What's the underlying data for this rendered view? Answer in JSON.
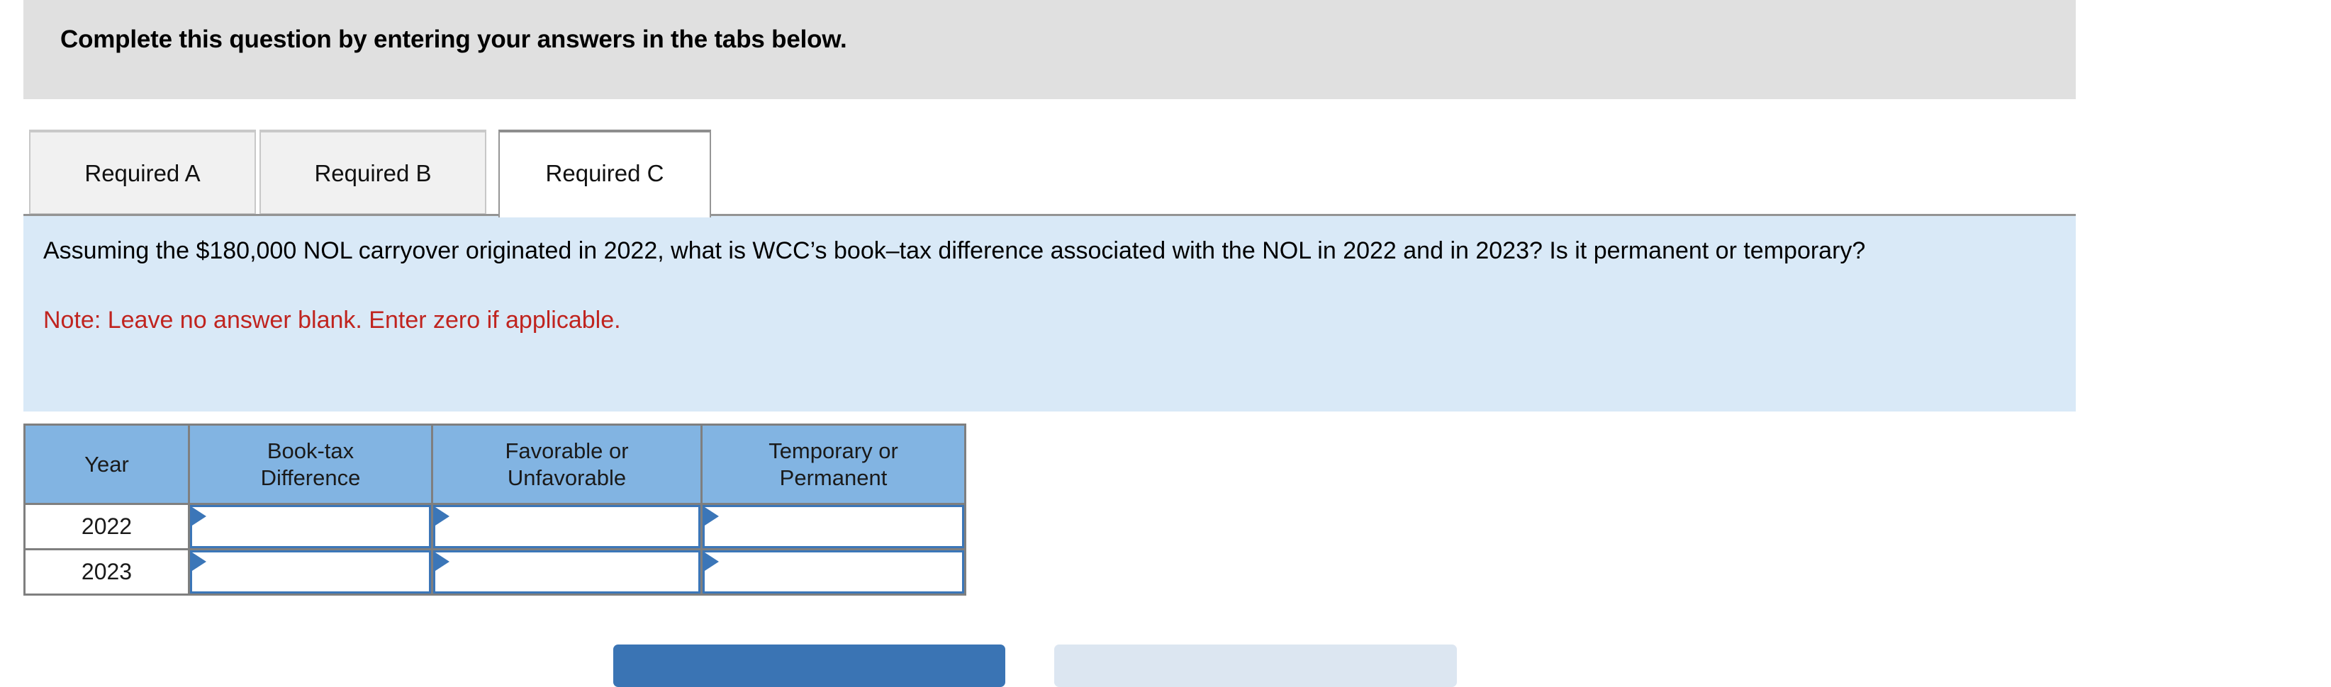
{
  "banner": {
    "text": "Complete this question by entering your answers in the tabs below."
  },
  "tabs": [
    {
      "label": "Required A",
      "active": false
    },
    {
      "label": "Required B",
      "active": false
    },
    {
      "label": "Required C",
      "active": true
    }
  ],
  "question": {
    "text": "Assuming the $180,000 NOL carryover originated in 2022, what is WCC’s book–tax difference associated with the NOL in 2022 and in 2023? Is it permanent or temporary?",
    "note": "Note: Leave no answer blank. Enter zero if applicable."
  },
  "table": {
    "headers": {
      "year": "Year",
      "book_tax_difference": "Book-tax\nDifference",
      "favorable_or_unfavorable": "Favorable or\nUnfavorable",
      "temporary_or_permanent": "Temporary or\nPermanent"
    },
    "rows": [
      {
        "year": "2022",
        "book_tax_difference": "",
        "favorable_or_unfavorable": "",
        "temporary_or_permanent": ""
      },
      {
        "year": "2023",
        "book_tax_difference": "",
        "favorable_or_unfavorable": "",
        "temporary_or_permanent": ""
      }
    ]
  },
  "footer": {
    "prev_label": "",
    "next_label": ""
  },
  "colors": {
    "banner_bg": "#e0e0e0",
    "question_bg": "#d9e9f7",
    "note_text": "#c0241f",
    "table_header_bg": "#82b4e2",
    "input_border": "#3b76b8",
    "primary_button": "#3a74b4",
    "secondary_button": "#dce6f1"
  }
}
